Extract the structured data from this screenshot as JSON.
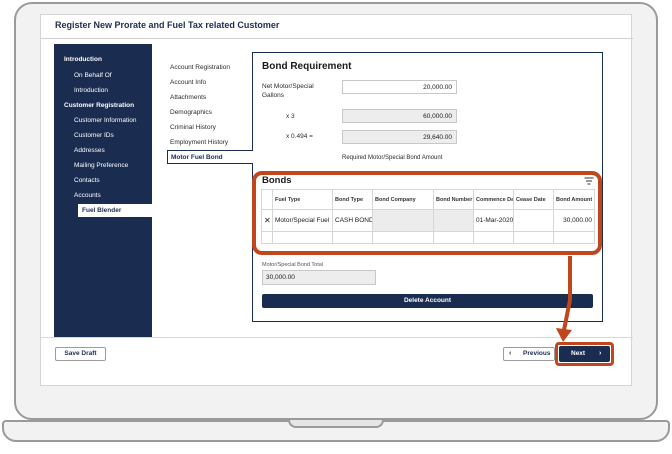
{
  "app": {
    "title": "Register New Prorate and Fuel Tax related Customer"
  },
  "left_nav": {
    "items": [
      {
        "label": "Introduction",
        "bold": true
      },
      {
        "label": "On Behalf Of",
        "bold": false
      },
      {
        "label": "Introduction",
        "bold": false
      },
      {
        "label": "Customer Registration",
        "bold": true
      },
      {
        "label": "Customer Information",
        "bold": false
      },
      {
        "label": "Customer IDs",
        "bold": false
      },
      {
        "label": "Addresses",
        "bold": false
      },
      {
        "label": "Mailing Preference",
        "bold": false
      },
      {
        "label": "Contacts",
        "bold": false
      },
      {
        "label": "Accounts",
        "bold": false
      }
    ],
    "active_item": "Fuel Blender"
  },
  "sub_nav": {
    "items": [
      "Account Registration",
      "Account Info",
      "Attachments",
      "Demographics",
      "Criminal History",
      "Employment History"
    ],
    "active_item": "Motor Fuel Bond"
  },
  "bond_requirement": {
    "heading": "Bond Requirement",
    "net_label": "Net Motor/Special Gallons",
    "net_value": "20,000.00",
    "multiplier_label": "x  3",
    "multiplier_value": "60,000.00",
    "rate_label": "x 0.494  =",
    "rate_value": "29,640.00",
    "required_label": "Required Motor/Special Bond Amount"
  },
  "bonds": {
    "title": "Bonds",
    "filter_icon": "filter-icon",
    "columns": [
      "",
      "Fuel Type",
      "Bond Type",
      "Bond Company",
      "Bond Number",
      "Commence Date",
      "Cease Date",
      "Bond Amount"
    ],
    "rows": [
      {
        "remove": "✕",
        "fuel_type": "Motor/Special Fuel",
        "bond_type": "CASH BOND",
        "bond_company": "",
        "bond_number": "",
        "commence_date": "01-Mar-2020",
        "cease_date": "",
        "bond_amount": "30,000.00"
      }
    ]
  },
  "total": {
    "label": "Motor/Special Bond Total",
    "value": "30,000.00"
  },
  "actions": {
    "delete_label": "Delete Account",
    "save_draft_label": "Save Draft",
    "previous_label": "Previous",
    "next_label": "Next",
    "prev_chevron": "‹",
    "next_chevron": "›"
  },
  "colors": {
    "navy": "#1a2c50",
    "highlight": "#c0461b"
  }
}
